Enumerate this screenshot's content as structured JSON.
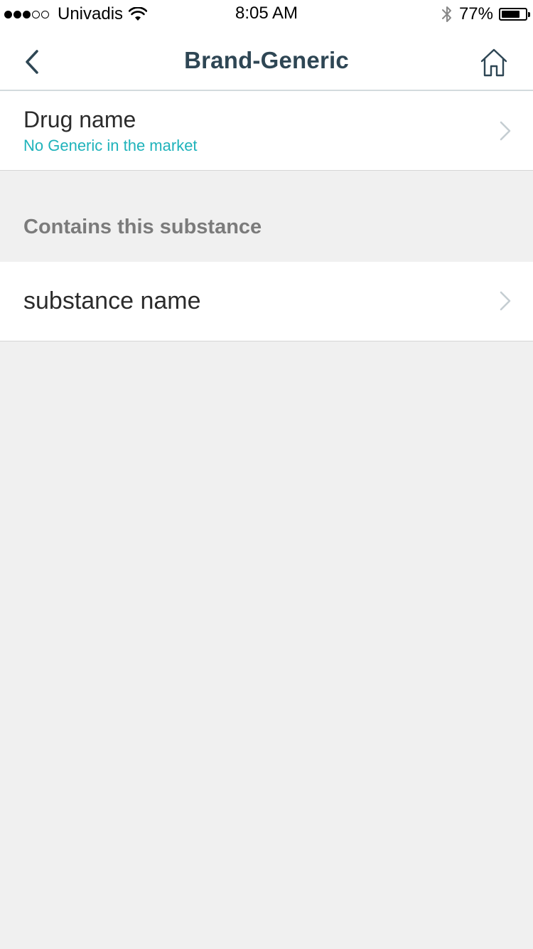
{
  "status_bar": {
    "signal_dots_filled": 3,
    "signal_dots_total": 5,
    "carrier": "Univadis",
    "time": "8:05 AM",
    "battery_percent_label": "77%",
    "battery_level": 0.77
  },
  "nav": {
    "title": "Brand-Generic",
    "back_icon": "chevron-left-icon",
    "home_icon": "home-icon"
  },
  "drug_row": {
    "title": "Drug name",
    "subtitle": "No Generic in the market"
  },
  "section": {
    "header": "Contains this substance"
  },
  "substance_row": {
    "title": "substance name"
  },
  "colors": {
    "accent": "#1fb3bb",
    "title": "#2e4654",
    "background": "#f0f0f0"
  }
}
